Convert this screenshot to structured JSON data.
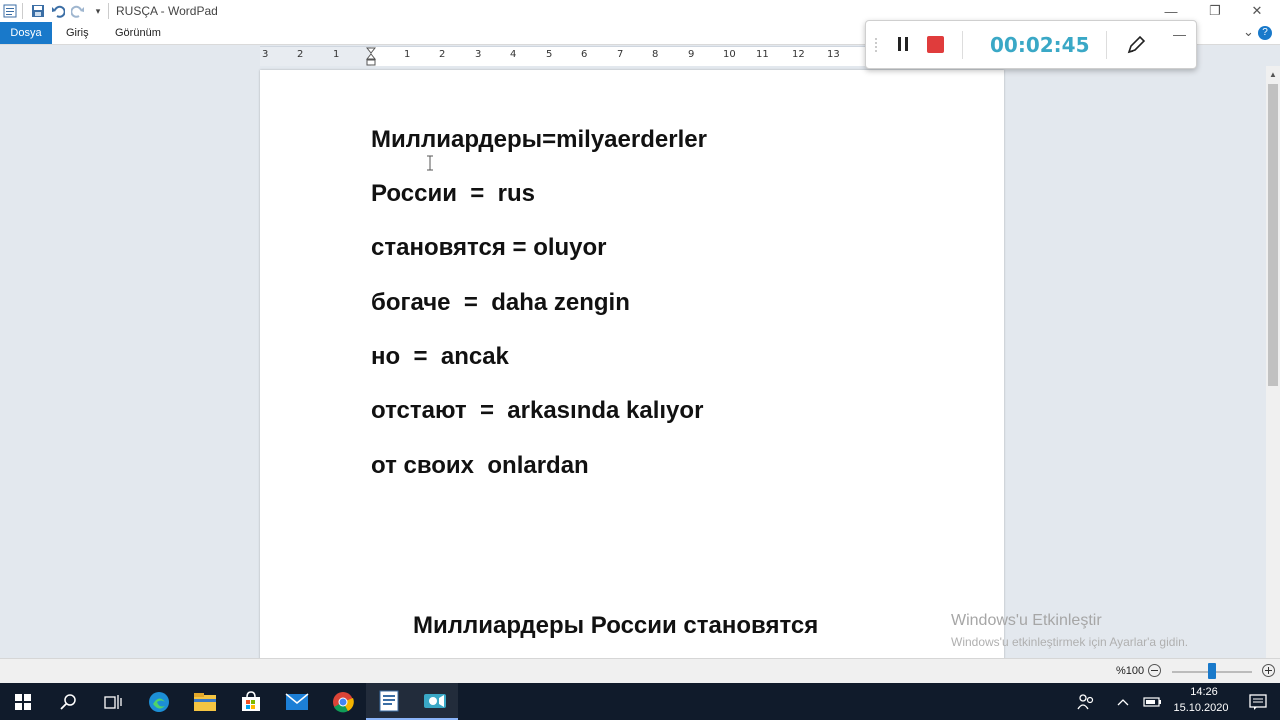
{
  "window": {
    "title": "RUSÇA - WordPad",
    "minimize_glyph": "—",
    "restore_glyph": "❐",
    "close_glyph": "✕"
  },
  "ribbon": {
    "tabs": [
      {
        "label": "Dosya"
      },
      {
        "label": "Giriş"
      },
      {
        "label": "Görünüm"
      }
    ],
    "collapse_glyph": "⌄",
    "help_glyph": "?"
  },
  "ruler": {
    "labels": [
      "3",
      "2",
      "1",
      "1",
      "2",
      "3",
      "4",
      "5",
      "6",
      "7",
      "8",
      "9",
      "10",
      "11",
      "12",
      "13"
    ]
  },
  "recorder": {
    "elapsed": "00:02:45",
    "minimize_glyph": "—"
  },
  "document": {
    "lines": [
      "Миллиардеры=milyaerderler",
      "России  =  rus",
      "становятся = oluyor",
      "богаче  =  daha zengin",
      "но  =  ancak",
      "отстают  =  arkasında kalıyor",
      "от своих  onlardan"
    ],
    "title": "Миллиардеры России становятся"
  },
  "watermark": {
    "line1": "Windows'u Etkinleştir",
    "line2": "Windows'u etkinleştirmek için Ayarlar'a gidin."
  },
  "statusbar": {
    "zoom": "%100",
    "zoom_level": 1.0
  },
  "taskbar": {
    "time": "14:26",
    "date": "15.10.2020"
  },
  "colors": {
    "accent": "#1979ca",
    "timer": "#3aa8c6",
    "stop": "#e03c3c",
    "taskbar": "#101b2b"
  }
}
